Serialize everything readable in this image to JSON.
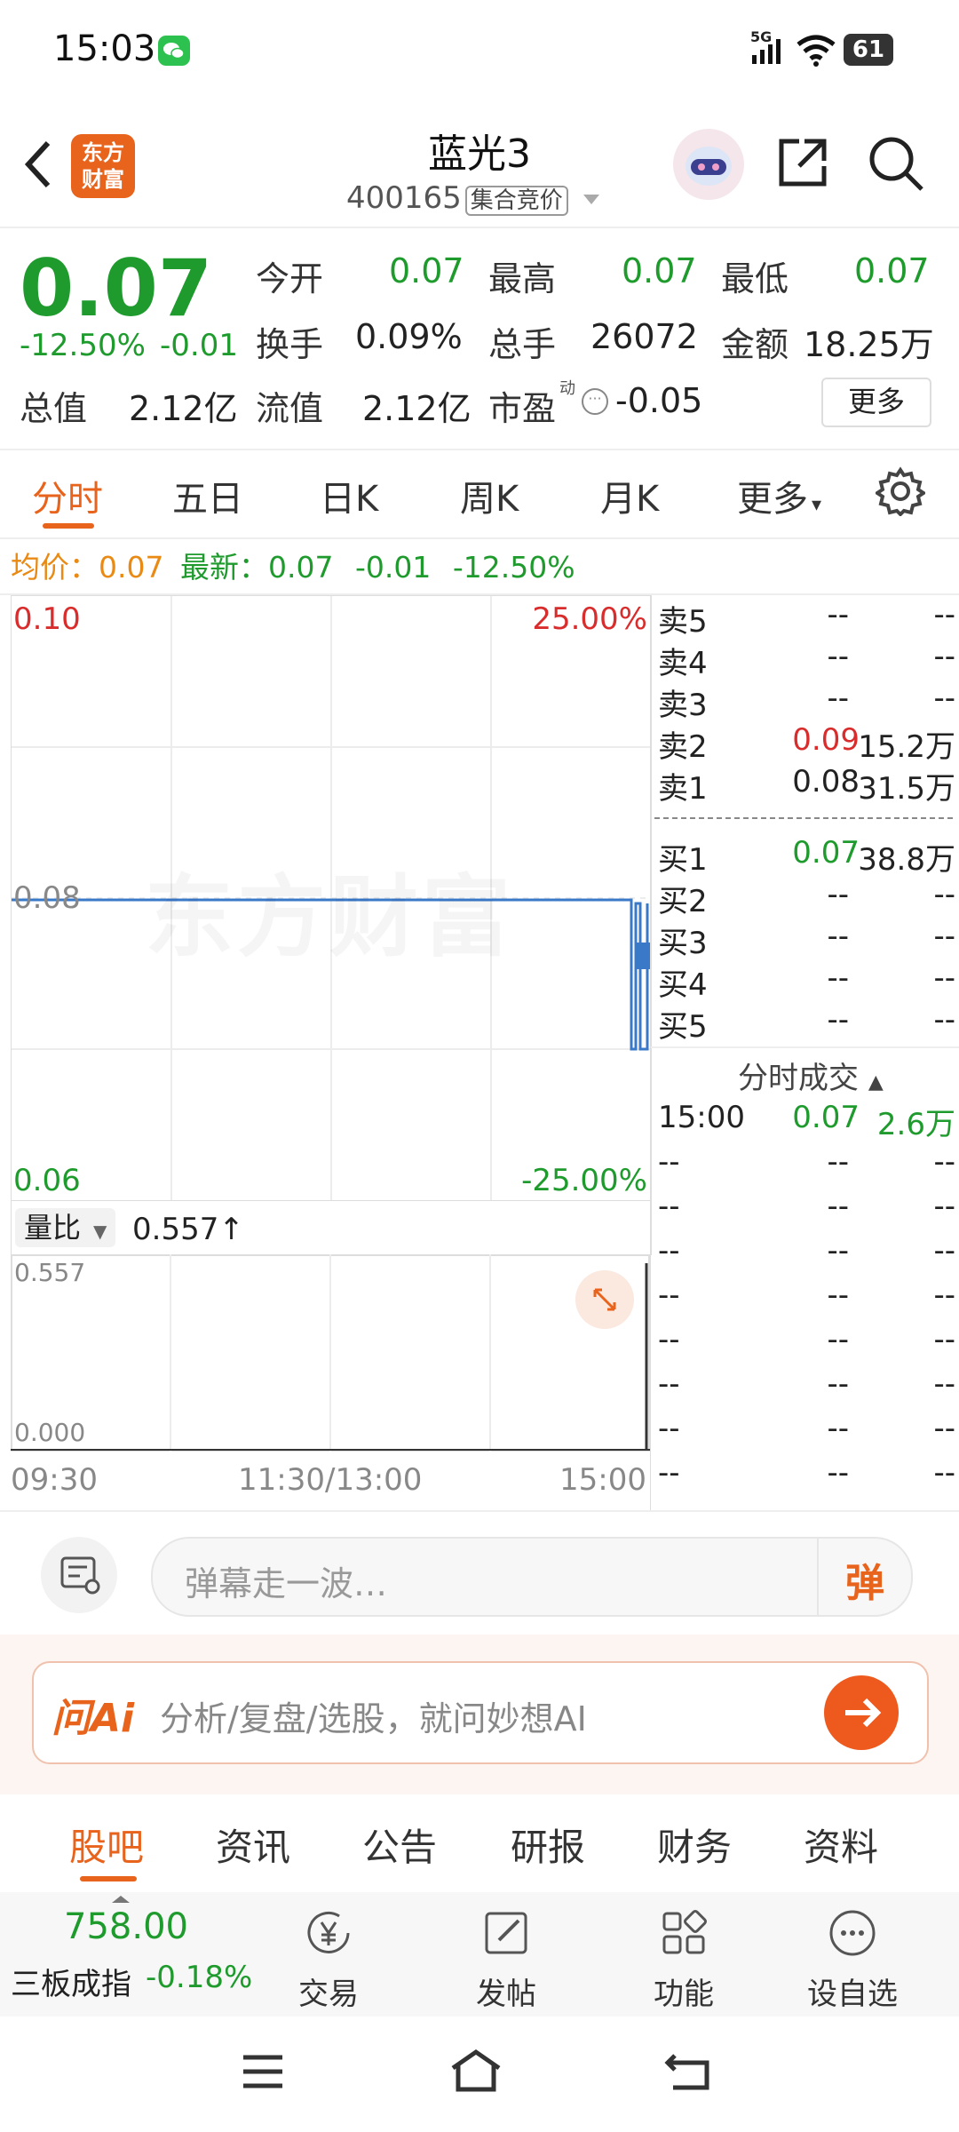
{
  "status_bar": {
    "time": "15:03",
    "network": "5G",
    "battery": "61"
  },
  "header": {
    "stock_name": "蓝光3",
    "stock_code": "400165",
    "auction_tag": "集合竞价",
    "logo_text_1": "东方",
    "logo_text_2": "财富"
  },
  "quote": {
    "price": "0.07",
    "change_pct": "-12.50%",
    "change": "-0.01",
    "open_label": "今开",
    "open": "0.07",
    "high_label": "最高",
    "high": "0.07",
    "low_label": "最低",
    "low": "0.07",
    "turnover_label": "换手",
    "turnover": "0.09%",
    "volume_label": "总手",
    "volume": "26072",
    "amount_label": "金额",
    "amount": "18.25万",
    "mktcap_label": "总值",
    "mktcap": "2.12亿",
    "float_label": "流值",
    "float": "2.12亿",
    "pe_label": "市盈",
    "pe_sup": "动",
    "pe": "-0.05",
    "more_button": "更多"
  },
  "chart_tabs": [
    "分时",
    "五日",
    "日K",
    "周K",
    "月K",
    "更多"
  ],
  "summary": {
    "avg_label": "均价：",
    "avg": "0.07",
    "latest_label": "最新：",
    "latest": "0.07",
    "change": "-0.01",
    "change_pct": "-12.50%"
  },
  "chart": {
    "y_top": "0.10",
    "y_mid": "0.08",
    "y_bottom": "0.06",
    "pct_top": "25.00%",
    "pct_bottom": "-25.00%",
    "watermark": "东方财富",
    "x_start": "09:30",
    "x_mid": "11:30/13:00",
    "x_end": "15:00",
    "ratio_label": "量比",
    "ratio_value": "0.557↑",
    "vol_top": "0.557",
    "vol_bottom": "0.000"
  },
  "orderbook": {
    "asks": [
      {
        "label": "卖5",
        "price": "--",
        "vol": "--"
      },
      {
        "label": "卖4",
        "price": "--",
        "vol": "--"
      },
      {
        "label": "卖3",
        "price": "--",
        "vol": "--"
      },
      {
        "label": "卖2",
        "price": "0.09",
        "vol": "15.2万"
      },
      {
        "label": "卖1",
        "price": "0.08",
        "vol": "31.5万"
      }
    ],
    "bids": [
      {
        "label": "买1",
        "price": "0.07",
        "vol": "38.8万"
      },
      {
        "label": "买2",
        "price": "--",
        "vol": "--"
      },
      {
        "label": "买3",
        "price": "--",
        "vol": "--"
      },
      {
        "label": "买4",
        "price": "--",
        "vol": "--"
      },
      {
        "label": "买5",
        "price": "--",
        "vol": "--"
      }
    ],
    "trades_title": "分时成交",
    "trades": [
      {
        "time": "15:00",
        "price": "0.07",
        "vol": "2.6万"
      },
      {
        "time": "--",
        "price": "--",
        "vol": "--"
      },
      {
        "time": "--",
        "price": "--",
        "vol": "--"
      },
      {
        "time": "--",
        "price": "--",
        "vol": "--"
      },
      {
        "time": "--",
        "price": "--",
        "vol": "--"
      },
      {
        "time": "--",
        "price": "--",
        "vol": "--"
      },
      {
        "time": "--",
        "price": "--",
        "vol": "--"
      },
      {
        "time": "--",
        "price": "--",
        "vol": "--"
      },
      {
        "time": "--",
        "price": "--",
        "vol": "--"
      }
    ]
  },
  "comment": {
    "placeholder": "弹幕走一波…",
    "danmu_button": "弹"
  },
  "ai": {
    "logo": "问Ai",
    "placeholder": "分析/复盘/选股，就问妙想AI"
  },
  "news_tabs": [
    "股吧",
    "资讯",
    "公告",
    "研报",
    "财务",
    "资料"
  ],
  "bottom_bar": {
    "index_value": "758.00",
    "index_name": "三板成指",
    "index_change": "-0.18%",
    "trade": "交易",
    "post": "发帖",
    "function": "功能",
    "watchlist": "设自选"
  },
  "colors": {
    "up": "#d92c2c",
    "down": "#1f9b2e",
    "accent": "#e8631c",
    "avg": "#e98a15"
  }
}
